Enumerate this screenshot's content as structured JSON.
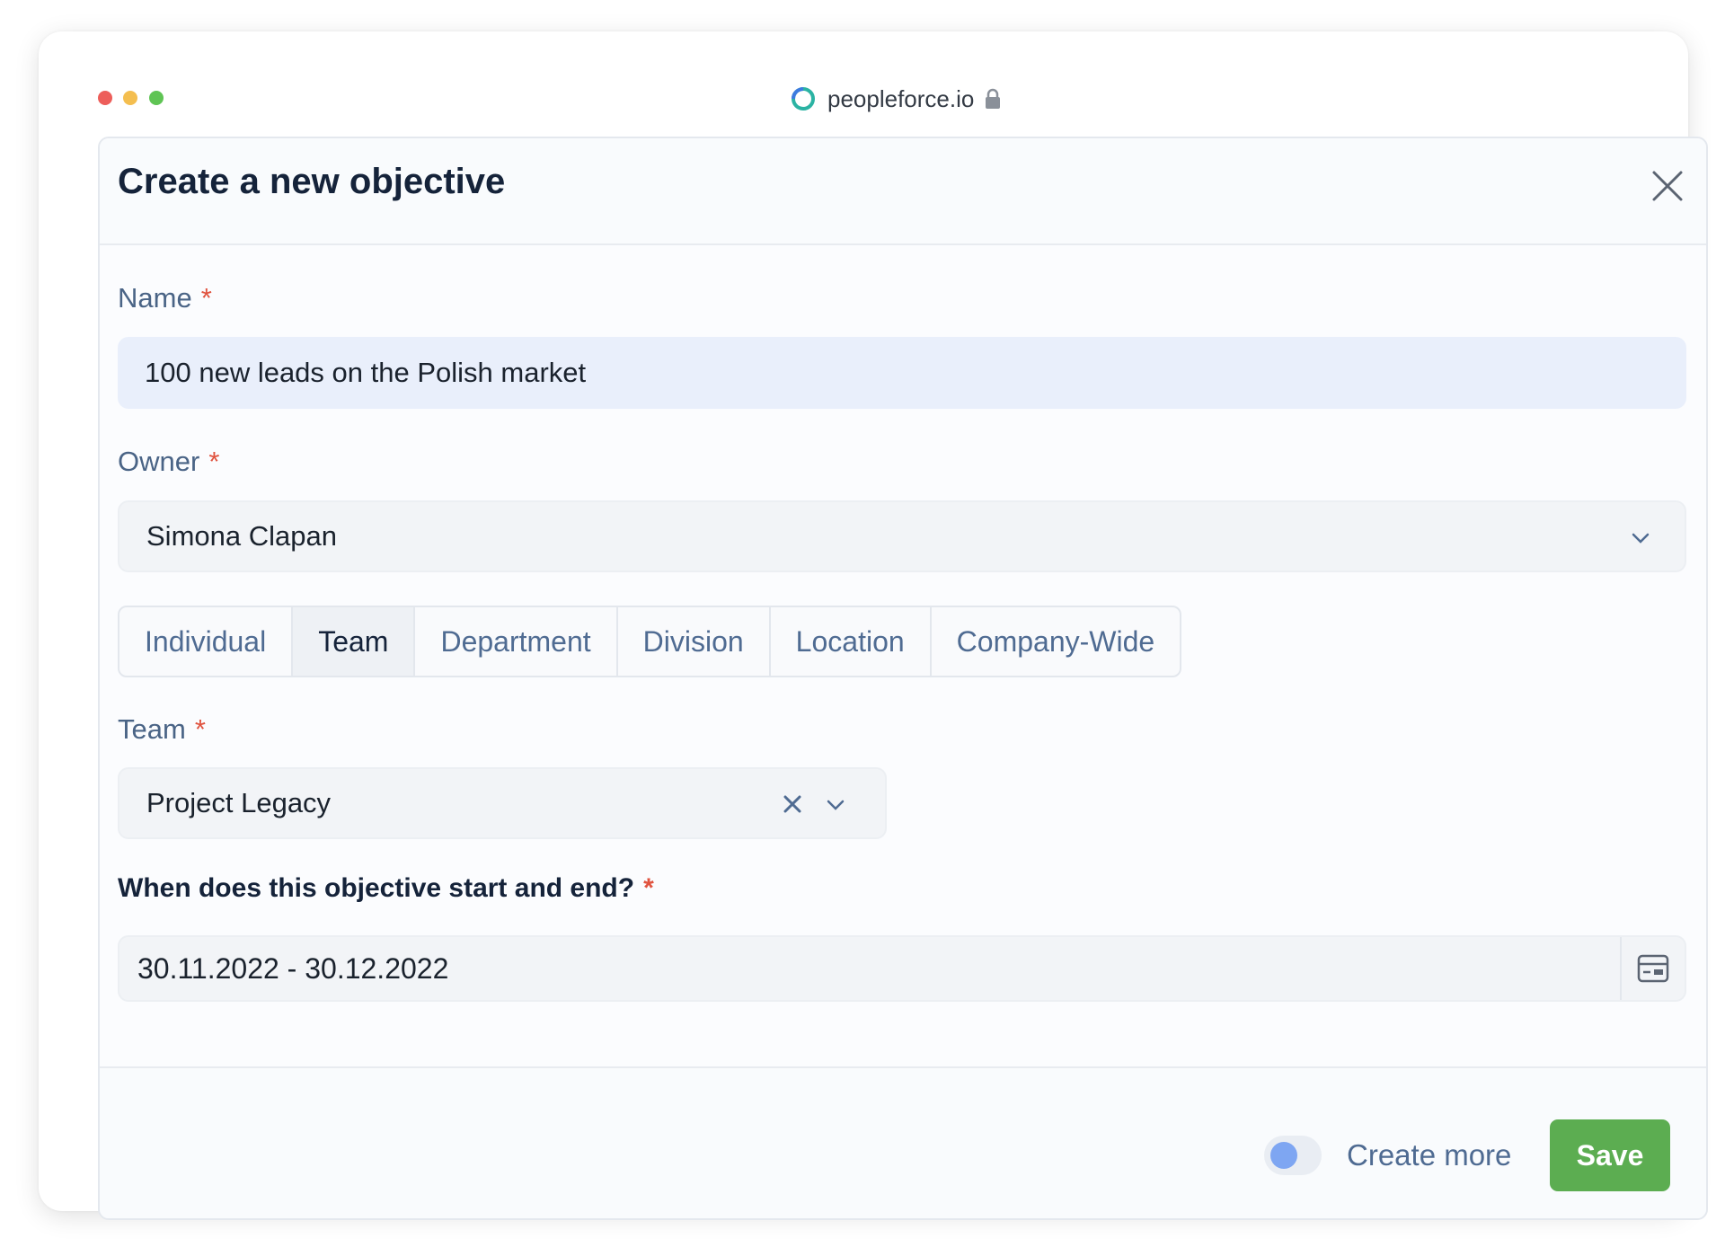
{
  "browser": {
    "url": "peopleforce.io"
  },
  "modal": {
    "title": "Create a new objective",
    "name": {
      "label": "Name",
      "required_mark": "*",
      "value": "100 new leads on the Polish market"
    },
    "owner": {
      "label": "Owner",
      "required_mark": "*",
      "value": "Simona Clapan"
    },
    "scope_tabs": [
      {
        "label": "Individual",
        "active": false
      },
      {
        "label": "Team",
        "active": true
      },
      {
        "label": "Department",
        "active": false
      },
      {
        "label": "Division",
        "active": false
      },
      {
        "label": "Location",
        "active": false
      },
      {
        "label": "Company-Wide",
        "active": false
      }
    ],
    "team": {
      "label": "Team",
      "required_mark": "*",
      "value": "Project Legacy"
    },
    "dates": {
      "label": "When does this objective start and end?",
      "required_mark": "*",
      "value": "30.11.2022 - 30.12.2022"
    },
    "footer": {
      "create_more_label": "Create more",
      "create_more_enabled": false,
      "save_label": "Save"
    }
  },
  "colors": {
    "accent_green": "#5cad51",
    "required_red": "#e0533f",
    "label_blue": "#4a6486",
    "title_dark": "#15233a"
  },
  "icons": {
    "close": "close-icon",
    "chevron": "chevron-down-icon",
    "clear": "clear-x-icon",
    "calendar": "calendar-icon",
    "lock": "lock-icon",
    "logo": "peopleforce-logo-icon"
  }
}
